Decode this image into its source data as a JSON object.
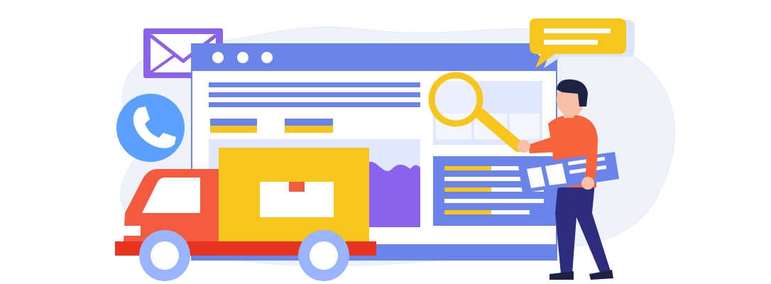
{
  "illustration": {
    "colors": {
      "blob": "#eef3fb",
      "browser_frame": "#6b84ec",
      "browser_panel": "#dfe8ff",
      "accent_yellow": "#f7c51b",
      "accent_red": "#f35b3f",
      "accent_purple": "#8a62eb",
      "envelope": "#8a62eb",
      "phone_circle": "#5aa0ff",
      "person_shirt": "#f7643b",
      "person_pants": "#2e2c7f",
      "person_hair": "#1b2445",
      "skin": "#f7c0a7",
      "wheel": "#9ab5ff"
    },
    "icons": [
      "mail-icon",
      "phone-icon",
      "chat-bubble-icon",
      "magnifier-icon",
      "delivery-truck-icon",
      "package-icon"
    ]
  }
}
